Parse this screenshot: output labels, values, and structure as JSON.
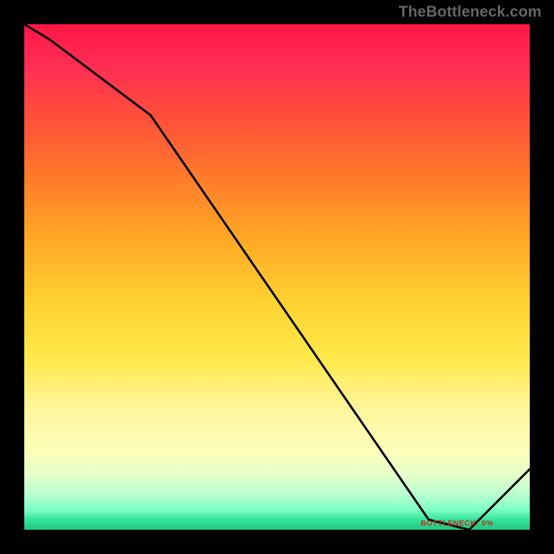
{
  "attribution": "TheBottleneck.com",
  "label_text": "BOTTLENECK: 0%",
  "chart_data": {
    "type": "line",
    "title": "",
    "xlabel": "",
    "ylabel": "",
    "x": [
      0.0,
      0.05,
      0.25,
      0.8,
      0.88,
      1.0
    ],
    "values": [
      1.0,
      0.97,
      0.82,
      0.02,
      0.0,
      0.12
    ],
    "xlim": [
      0,
      1
    ],
    "ylim": [
      0,
      1
    ],
    "optimal_region": {
      "x_start": 0.79,
      "x_end": 0.91
    },
    "background": "rainbow-vertical",
    "annotations": [
      {
        "text": "BOTTLENECK: 0%",
        "x": 0.85,
        "y": 0.012
      }
    ]
  },
  "colors": {
    "line": "#000000",
    "label": "#c62828",
    "frame": "#000000"
  }
}
